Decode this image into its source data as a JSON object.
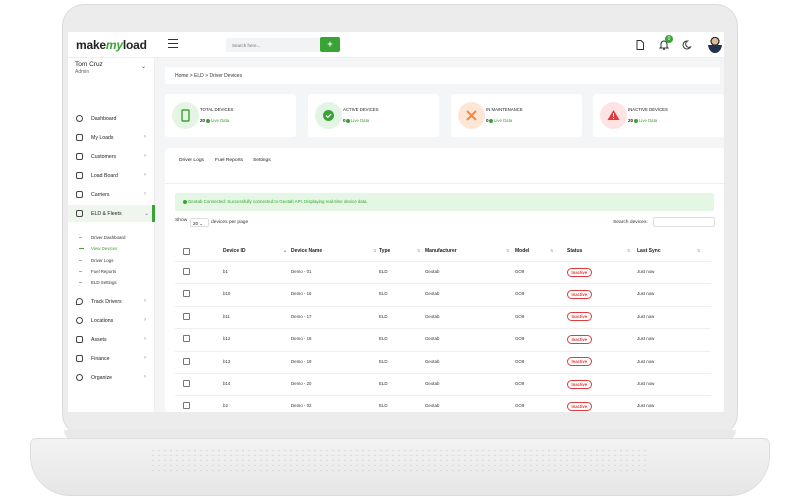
{
  "app": {
    "logo_prefix": "make",
    "logo_my": "my",
    "logo_suffix": "load"
  },
  "topbar": {
    "search_placeholder": "Search here...",
    "search_button": "+",
    "notification_count": "0"
  },
  "user": {
    "name": "Tom Cruz",
    "role": "Admin"
  },
  "sidebar": {
    "items": [
      {
        "label": "Dashboard",
        "icon": "gauge-icon"
      },
      {
        "label": "My Loads",
        "icon": "truck-icon"
      },
      {
        "label": "Customers",
        "icon": "handshake-icon"
      },
      {
        "label": "Load Board",
        "icon": "chart-icon"
      },
      {
        "label": "Carriers",
        "icon": "truck-icon"
      },
      {
        "label": "ELD & Fleets",
        "icon": "fleet-icon"
      },
      {
        "label": "Track Drivers",
        "icon": "location-pin-icon"
      },
      {
        "label": "Locations",
        "icon": "map-pin-icon"
      },
      {
        "label": "Assets",
        "icon": "lock-icon"
      },
      {
        "label": "Finance",
        "icon": "wallet-icon"
      },
      {
        "label": "Organize",
        "icon": "gear-icon"
      }
    ],
    "sub_items": [
      "Driver Dashboard",
      "View Devices",
      "Driver Logs",
      "Fuel Reports",
      "ELD Settings"
    ]
  },
  "breadcrumb": "Home  >  ELD  >  Driver Devices",
  "stats": [
    {
      "label": "TOTAL DEVICES",
      "value": "20",
      "live": "Live Data",
      "color": "#e6f4e4",
      "symbol_color": "#3aa335"
    },
    {
      "label": "ACTIVE DEVICES",
      "value": "0",
      "live": "Live Data",
      "color": "#e3f4e4",
      "symbol_color": "#3aa335"
    },
    {
      "label": "IN MAINTENANCE",
      "value": "0",
      "live": "Live Data",
      "color": "#fde6d6",
      "symbol_color": "#f08a3c"
    },
    {
      "label": "INACTIVE DEVICES",
      "value": "20",
      "live": "Live Data",
      "color": "#fde3e4",
      "symbol_color": "#e33b3b"
    }
  ],
  "tabs": [
    "Driver Logs",
    "Fuel Reports",
    "Settings"
  ],
  "alert": "Geotab Connected: Successfully connected to Geotab API. Displaying real-time device data.",
  "table_controls": {
    "show_label": "Show",
    "page_size": "20",
    "show_suffix": "devices per page",
    "search_label": "Search devices:"
  },
  "table": {
    "headers": [
      "Device ID",
      "Device Name",
      "Type",
      "Manufacturer",
      "Model",
      "Status",
      "Last Sync"
    ],
    "rows": [
      [
        "b1",
        "Demo - 01",
        "ELD",
        "Geotab",
        "GO9",
        "Inactive",
        "Just now"
      ],
      [
        "b10",
        "Demo - 16",
        "ELD",
        "Geotab",
        "GO9",
        "Inactive",
        "Just now"
      ],
      [
        "b11",
        "Demo - 17",
        "ELD",
        "Geotab",
        "GO9",
        "Inactive",
        "Just now"
      ],
      [
        "b12",
        "Demo - 18",
        "ELD",
        "Geotab",
        "GO9",
        "Inactive",
        "Just now"
      ],
      [
        "b13",
        "Demo - 19",
        "ELD",
        "Geotab",
        "GO9",
        "Inactive",
        "Just now"
      ],
      [
        "b14",
        "Demo - 20",
        "ELD",
        "Geotab",
        "GO9",
        "Inactive",
        "Just now"
      ],
      [
        "b2",
        "Demo - 02",
        "ELD",
        "Geotab",
        "GO9",
        "Inactive",
        "Just now"
      ]
    ]
  }
}
